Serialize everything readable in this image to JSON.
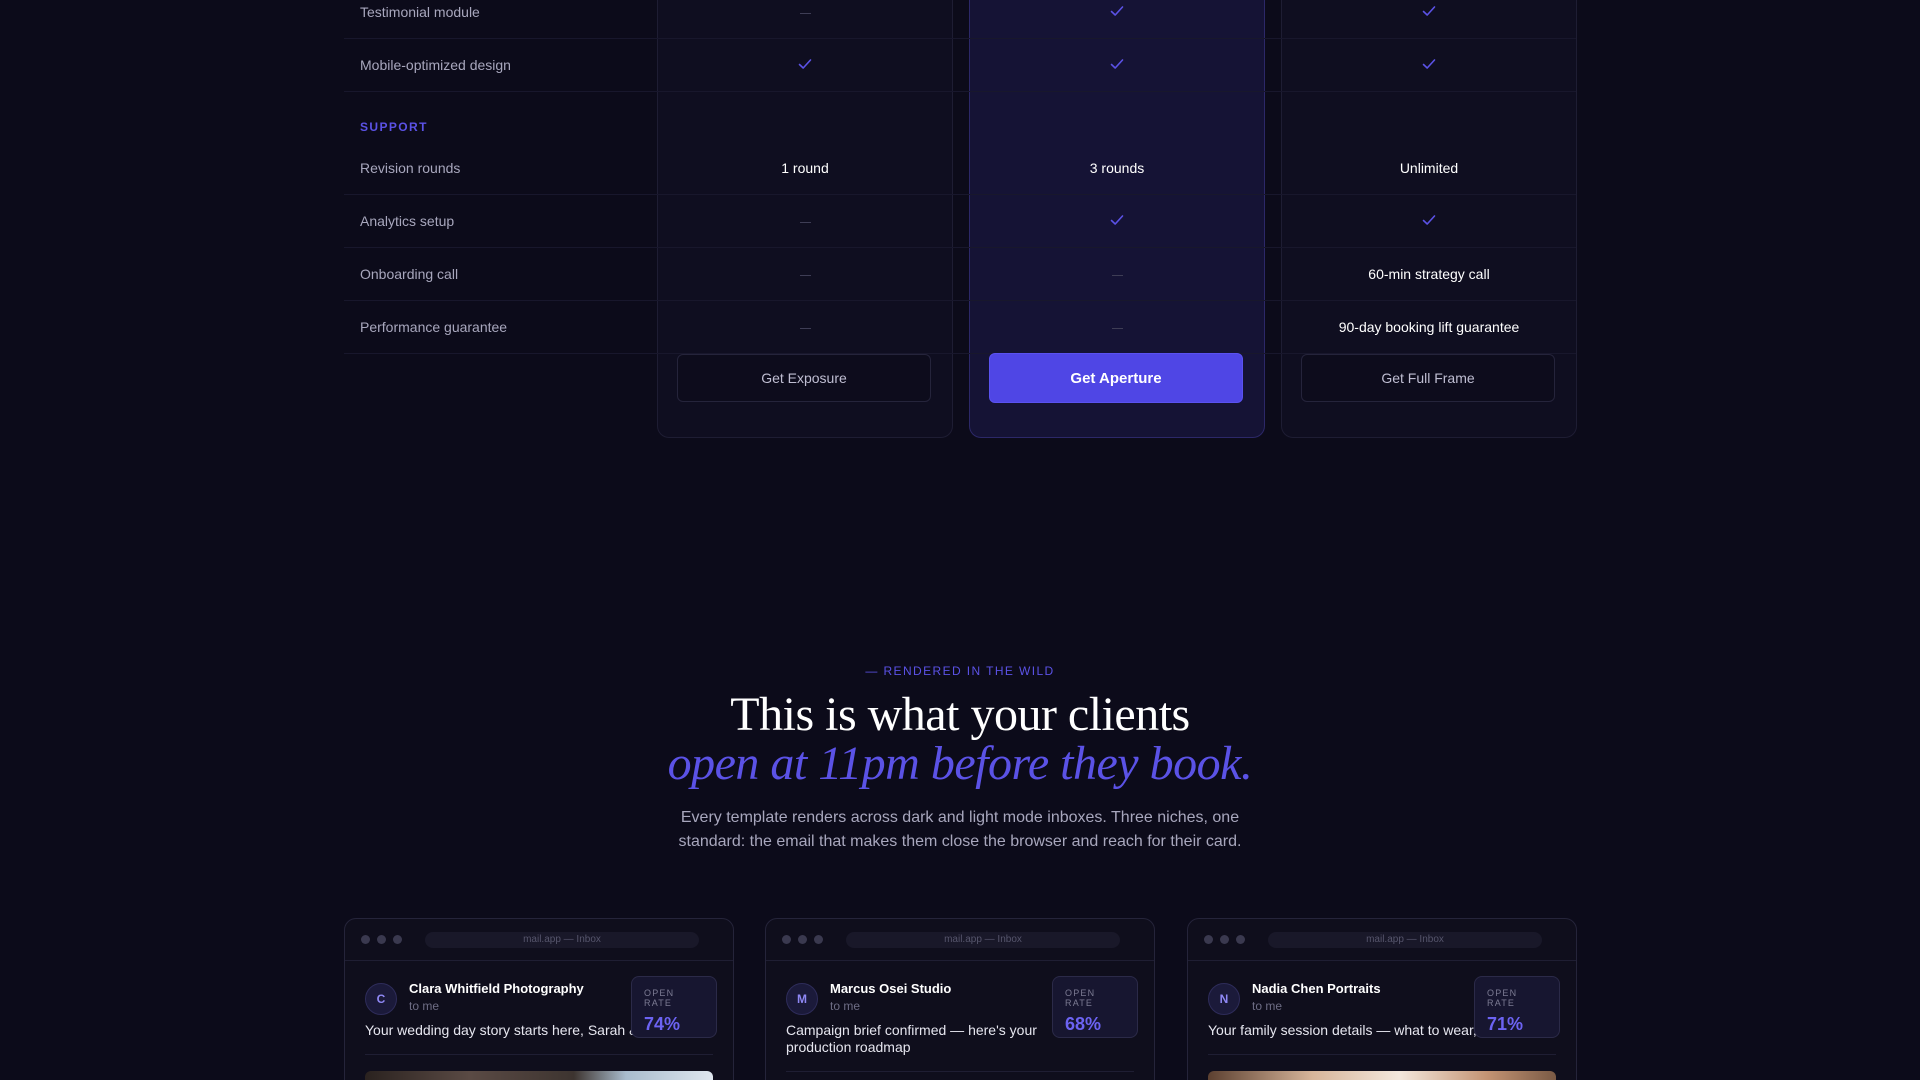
{
  "comparison": {
    "rows": [
      {
        "type": "row",
        "label": "Testimonial module",
        "values": [
          "dash",
          "check",
          "check"
        ]
      },
      {
        "type": "row",
        "label": "Mobile-optimized design",
        "values": [
          "check",
          "check",
          "check"
        ]
      },
      {
        "type": "section",
        "label": "SUPPORT"
      },
      {
        "type": "row",
        "label": "Revision rounds",
        "values": [
          "1 round",
          "3 rounds",
          "Unlimited"
        ]
      },
      {
        "type": "row",
        "label": "Analytics setup",
        "values": [
          "dash",
          "check",
          "check"
        ]
      },
      {
        "type": "row",
        "label": "Onboarding call",
        "values": [
          "dash",
          "dash",
          "60-min strategy call"
        ]
      },
      {
        "type": "row",
        "label": "Performance guarantee",
        "values": [
          "dash",
          "dash",
          "90-day booking lift guarantee"
        ]
      }
    ],
    "cta": {
      "exposure": "Get Exposure",
      "aperture": "Get Aperture",
      "full_frame": "Get Full Frame"
    },
    "accent_color": "#4f46e5"
  },
  "showcase": {
    "eyebrow": "— RENDERED IN THE WILD",
    "headline": "This is what your clients",
    "headline_accent": "open at 11pm before they book.",
    "subcopy": "Every template renders across dark and light mode inboxes. Three niches, one standard: the email that makes them close the browser and reach for their card."
  },
  "cards": [
    {
      "url": "mail.app — Inbox",
      "avatar": "C",
      "sender": "Clara Whitfield Photography",
      "to": "to me",
      "subject": "Your wedding day story starts here, Sarah & ...",
      "rate_label": "OPEN RATE",
      "rate_value": "74%"
    },
    {
      "url": "mail.app — Inbox",
      "avatar": "M",
      "sender": "Marcus Osei Studio",
      "to": "to me",
      "subject": "Campaign brief confirmed — here's your production roadmap",
      "rate_label": "OPEN RATE",
      "rate_value": "68%"
    },
    {
      "url": "mail.app — Inbox",
      "avatar": "N",
      "sender": "Nadia Chen Portraits",
      "to": "to me",
      "subject": "Your family session details — what to wear, ...",
      "rate_label": "OPEN RATE",
      "rate_value": "71%"
    }
  ]
}
